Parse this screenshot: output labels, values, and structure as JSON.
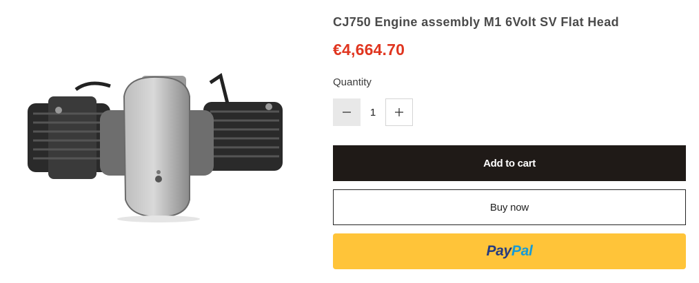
{
  "product": {
    "title": "CJ750 Engine assembly M1 6Volt SV Flat Head",
    "price": "€4,664.70",
    "image_alt": "engine-photo"
  },
  "quantity": {
    "label": "Quantity",
    "value": "1",
    "minus_icon": "minus-icon",
    "plus_icon": "plus-icon"
  },
  "buttons": {
    "add_to_cart": "Add to cart",
    "buy_now": "Buy now",
    "paypal_part1": "Pay",
    "paypal_part2": "Pal"
  },
  "colors": {
    "price": "#e0351f",
    "add_to_cart_bg": "#1f1a17",
    "paypal_bg": "#ffc439",
    "paypal_dark": "#253b80",
    "paypal_light": "#179bd7"
  }
}
